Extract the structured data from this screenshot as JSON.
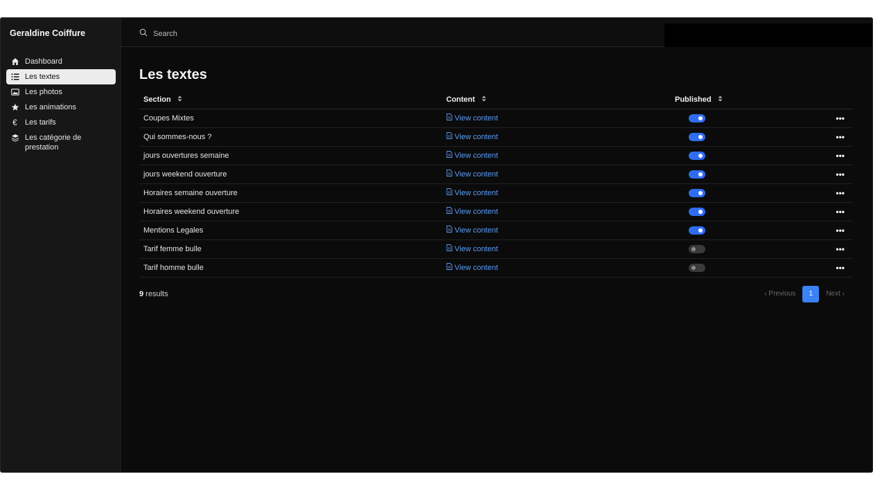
{
  "app": {
    "brand": "Geraldine Coiffure"
  },
  "sidebar": {
    "items": [
      {
        "label": "Dashboard",
        "icon": "home-icon",
        "active": false
      },
      {
        "label": "Les textes",
        "icon": "list-icon",
        "active": true
      },
      {
        "label": "Les photos",
        "icon": "photo-icon",
        "active": false
      },
      {
        "label": "Les animations",
        "icon": "star-icon",
        "active": false
      },
      {
        "label": "Les tarifs",
        "icon": "euro-icon",
        "active": false
      },
      {
        "label": "Les catégorie de prestation",
        "icon": "layers-icon",
        "active": false
      }
    ]
  },
  "search": {
    "placeholder": "Search",
    "value": ""
  },
  "page": {
    "title": "Les textes"
  },
  "table": {
    "headers": {
      "section": "Section",
      "content": "Content",
      "published": "Published"
    },
    "rows": [
      {
        "section": "Coupes Mixtes",
        "content": "View content",
        "published": true
      },
      {
        "section": "Qui sommes-nous ?",
        "content": "View content",
        "published": true
      },
      {
        "section": "jours ouvertures semaine",
        "content": "View content",
        "published": true
      },
      {
        "section": "jours weekend ouverture",
        "content": "View content",
        "published": true
      },
      {
        "section": "Horaires semaine ouverture",
        "content": "View content",
        "published": true
      },
      {
        "section": "Horaires weekend ouverture",
        "content": "View content",
        "published": true
      },
      {
        "section": "Mentions Legales",
        "content": "View content",
        "published": true
      },
      {
        "section": "Tarif femme bulle",
        "content": "View content",
        "published": false
      },
      {
        "section": "Tarif homme bulle",
        "content": "View content",
        "published": false
      }
    ],
    "actions_label": "•••"
  },
  "footer": {
    "results_count": "9",
    "results_label": " results",
    "previous": "Previous",
    "next": "Next",
    "current_page": "1"
  },
  "colors": {
    "accent": "#2f6df0",
    "link": "#5b9cf6",
    "background": "#0b0b0b",
    "sidebar": "#171717"
  }
}
